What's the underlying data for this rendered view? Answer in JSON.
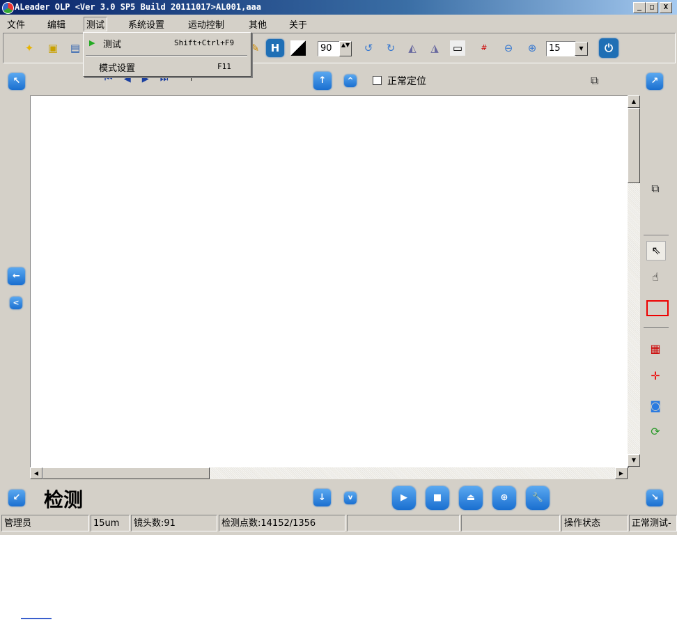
{
  "window": {
    "title": "ALeader OLP  <Ver 3.0 SP5  Build 20111017>AL001,aaa",
    "controls": [
      "_",
      "□",
      "X"
    ]
  },
  "menubar": [
    "文件",
    "编辑",
    "测试",
    "系统设置",
    "运动控制",
    "其他",
    "关于"
  ],
  "menu": {
    "items": [
      {
        "label": "测试",
        "shortcut": "Shift+Ctrl+F9"
      },
      {
        "label": "模式设置",
        "shortcut": "F11"
      }
    ]
  },
  "toolbar": {
    "angle_value": "90",
    "zoom_value": "15"
  },
  "nav": {
    "checkbox_label": "正常定位",
    "checked": false
  },
  "bottom": {
    "mode_label": "检测"
  },
  "status": [
    "管理员",
    "15um",
    "镜头数:91",
    "检测点数:14152/1356",
    "",
    "",
    "操作状态",
    "正常测试-"
  ],
  "colors": {
    "accent": "#1a6fd0",
    "title": "#0a246a",
    "face": "#d4d0c8"
  }
}
